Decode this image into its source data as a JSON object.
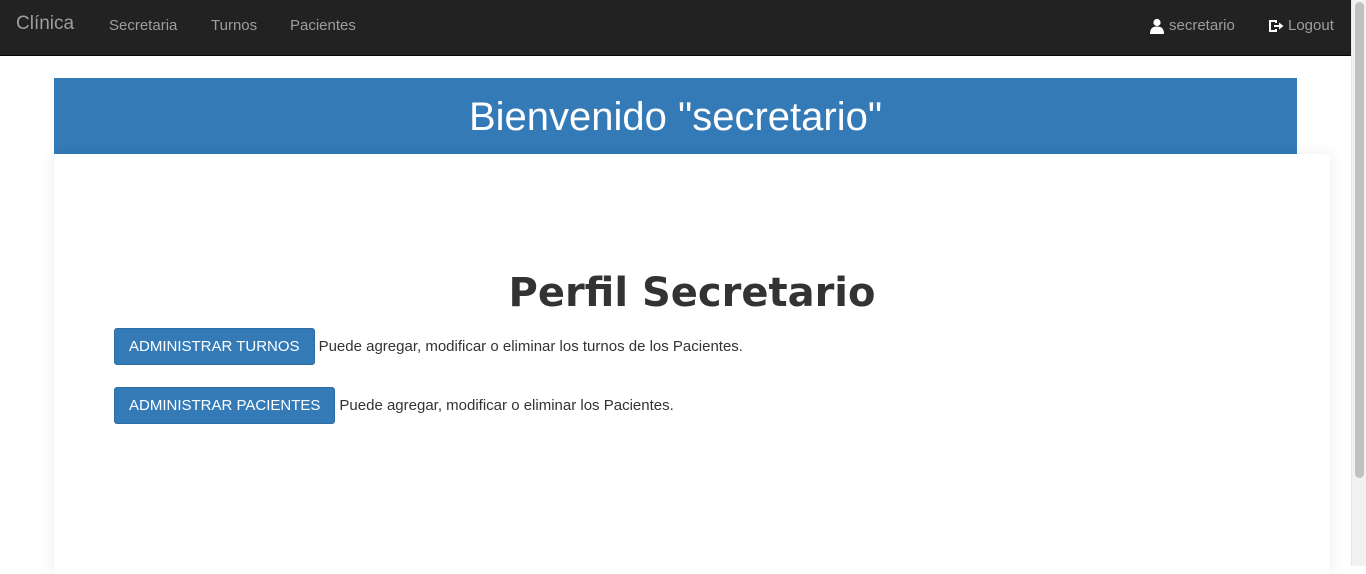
{
  "navbar": {
    "brand": "Clínica",
    "links": [
      "Secretaria",
      "Turnos",
      "Pacientes"
    ],
    "user_label": "secretario",
    "user_icon": "user-icon",
    "logout_label": "Logout",
    "logout_icon": "logout-icon"
  },
  "banner": {
    "title": "Bienvenido \"secretario\""
  },
  "main": {
    "title": "Perfil Secretario",
    "actions": [
      {
        "button": "ADMINISTRAR TURNOS",
        "description": "Puede agregar, modificar o eliminar los turnos de los Pacientes."
      },
      {
        "button": "ADMINISTRAR PACIENTES",
        "description": "Puede agregar, modificar o eliminar los Pacientes."
      }
    ]
  },
  "colors": {
    "navbar_bg": "#222222",
    "nav_text": "#9d9d9d",
    "primary": "#337ab7"
  }
}
